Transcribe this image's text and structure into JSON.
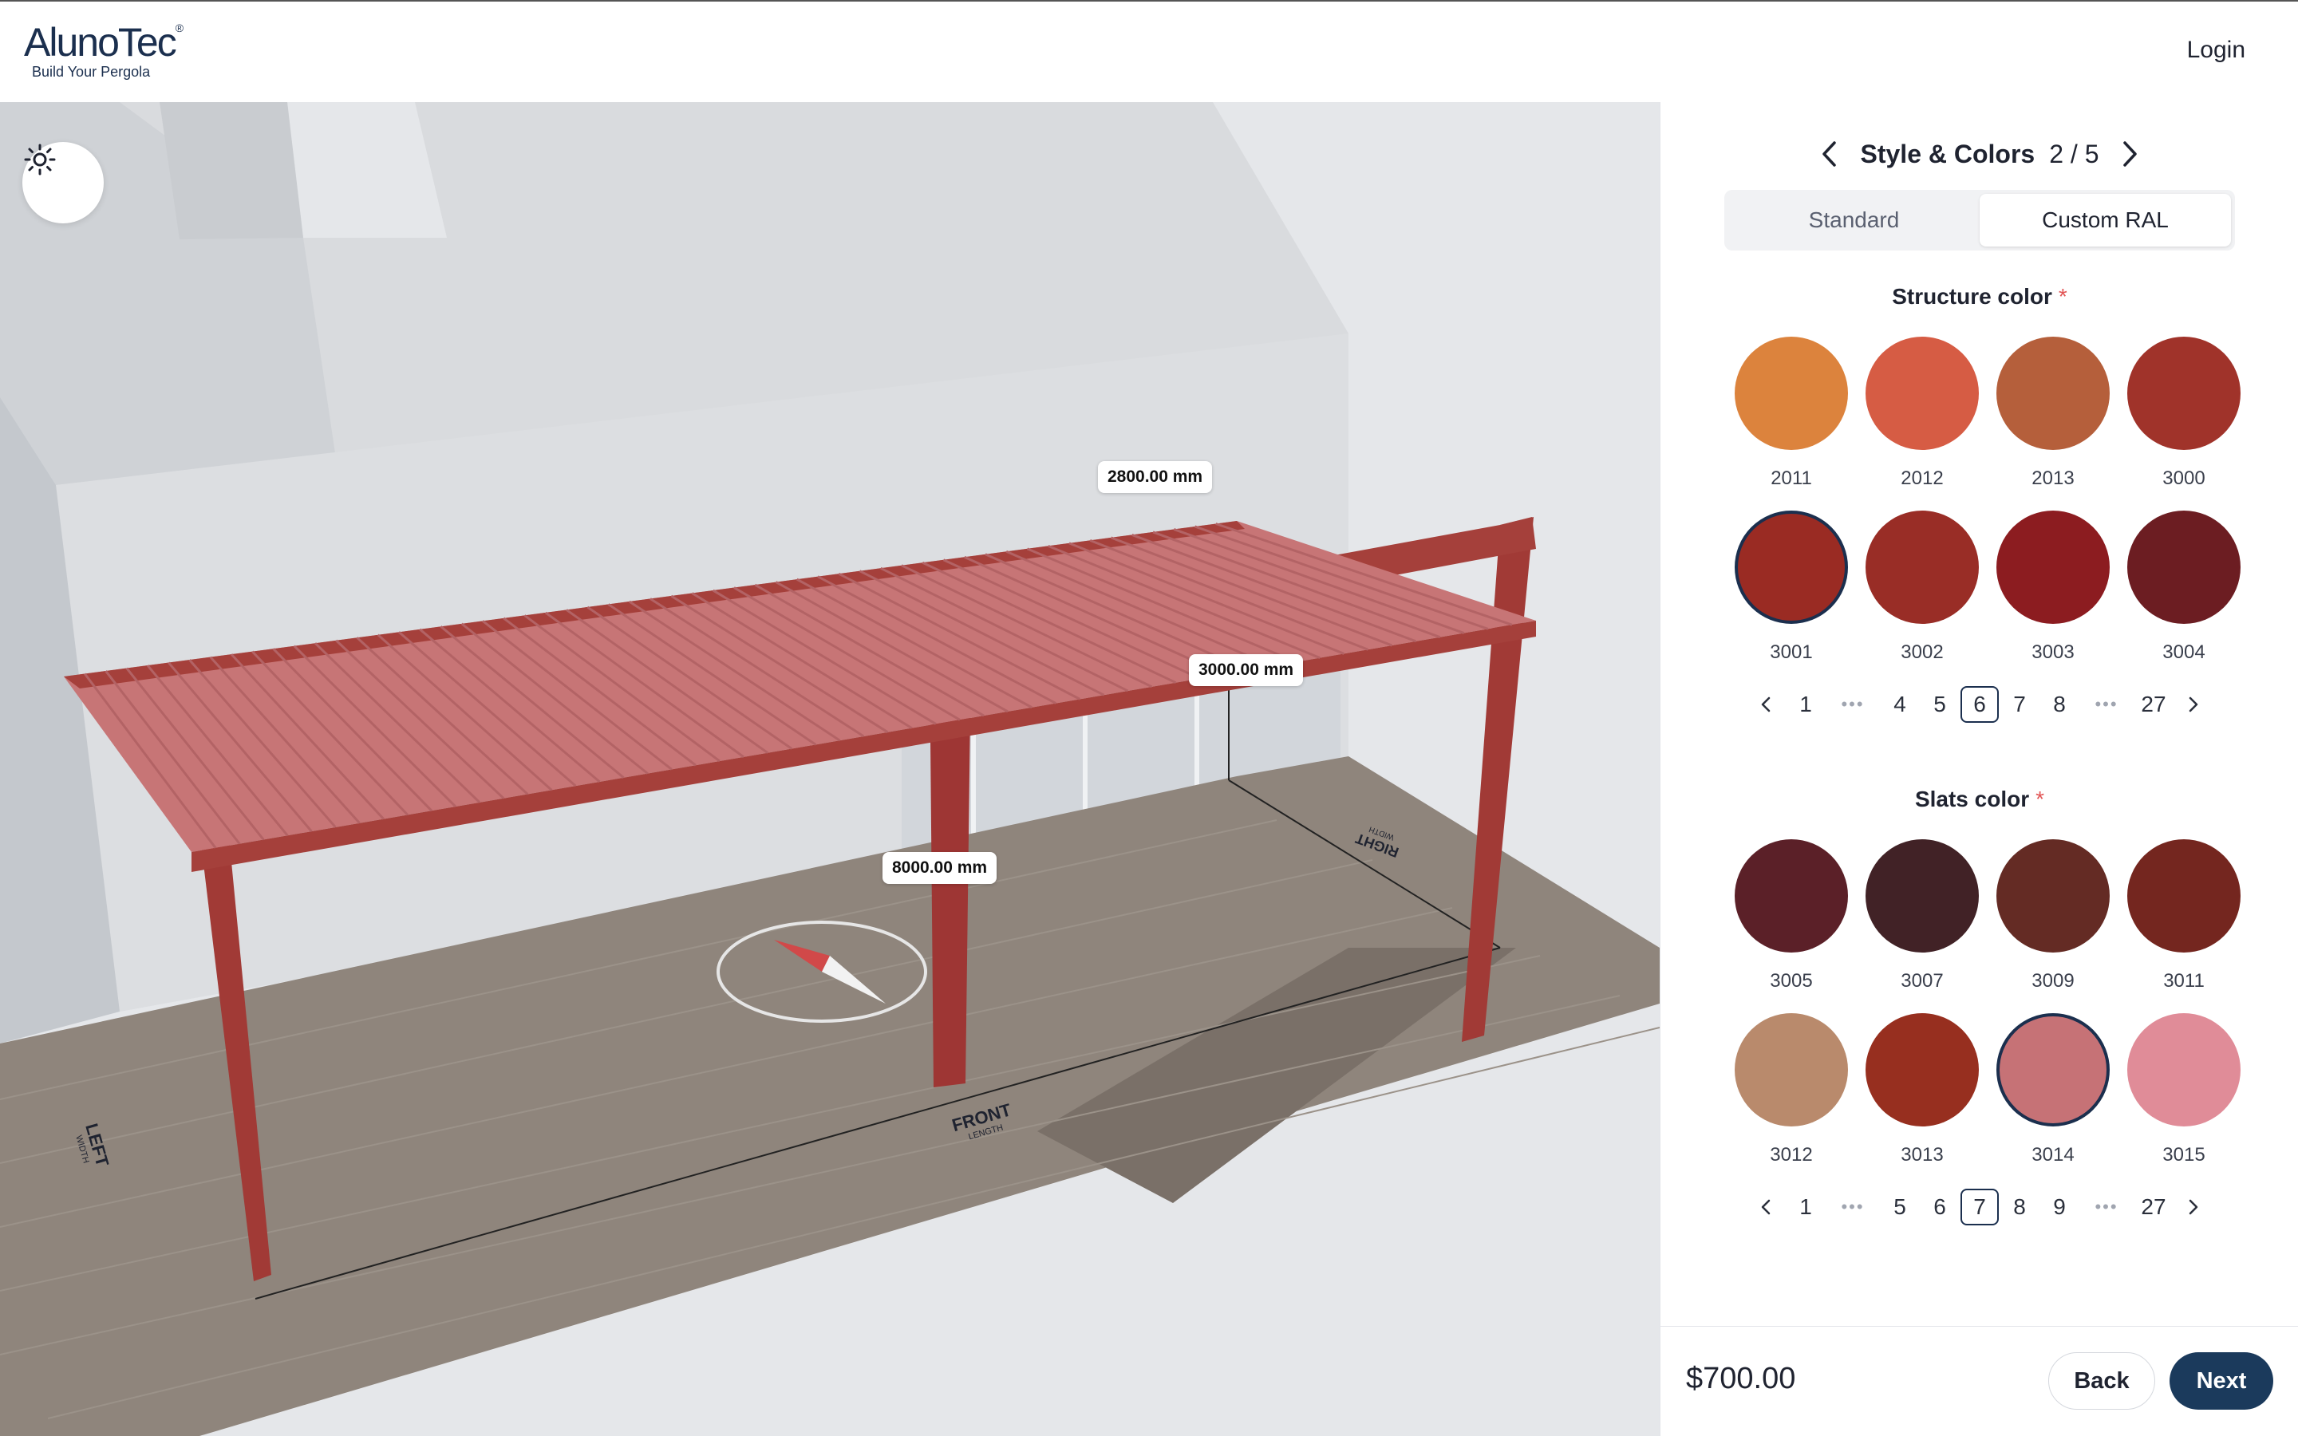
{
  "header": {
    "logo_main": "AlunoTec",
    "logo_reg": "®",
    "logo_tagline": "Build Your Pergola",
    "login_label": "Login"
  },
  "viewport": {
    "dimensions": {
      "depth": "2800.00 mm",
      "height": "3000.00 mm",
      "length": "8000.00 mm"
    },
    "ground_labels": {
      "front": "FRONT",
      "front_sub": "LENGTH",
      "left": "LEFT",
      "left_sub": "WIDTH",
      "right": "RIGHT",
      "right_sub": "WIDTH"
    },
    "icons": {
      "light": "sun-icon"
    },
    "colors": {
      "structure": "#9b3535",
      "slats": "#c77576",
      "deck": "#8f857c"
    }
  },
  "panel": {
    "step_title": "Style & Colors",
    "step_count": "2 / 5",
    "tabs": [
      {
        "label": "Standard",
        "active": false
      },
      {
        "label": "Custom RAL",
        "active": true
      }
    ],
    "structure": {
      "title": "Structure color",
      "required_mark": "*",
      "swatches": [
        {
          "code": "2011",
          "color": "#dc833d",
          "selected": false
        },
        {
          "code": "2012",
          "color": "#d65c44",
          "selected": false
        },
        {
          "code": "2013",
          "color": "#b55f3b",
          "selected": false
        },
        {
          "code": "3000",
          "color": "#a0332a",
          "selected": false
        },
        {
          "code": "3001",
          "color": "#9a2b23",
          "selected": true
        },
        {
          "code": "3002",
          "color": "#992d26",
          "selected": false
        },
        {
          "code": "3003",
          "color": "#8c1c20",
          "selected": false
        },
        {
          "code": "3004",
          "color": "#6c1d22",
          "selected": false
        }
      ],
      "pagination": [
        "1",
        "•••",
        "4",
        "5",
        "6",
        "7",
        "8",
        "•••",
        "27"
      ],
      "current_page": "6"
    },
    "slats": {
      "title": "Slats color",
      "required_mark": "*",
      "swatches": [
        {
          "code": "3005",
          "color": "#5b2028",
          "selected": false
        },
        {
          "code": "3007",
          "color": "#412226",
          "selected": false
        },
        {
          "code": "3009",
          "color": "#642b24",
          "selected": false
        },
        {
          "code": "3011",
          "color": "#74261f",
          "selected": false
        },
        {
          "code": "3012",
          "color": "#b98a6c",
          "selected": false
        },
        {
          "code": "3013",
          "color": "#972f1f",
          "selected": false
        },
        {
          "code": "3014",
          "color": "#c67276",
          "selected": true
        },
        {
          "code": "3015",
          "color": "#e08c98",
          "selected": false
        }
      ],
      "pagination": [
        "1",
        "•••",
        "5",
        "6",
        "7",
        "8",
        "9",
        "•••",
        "27"
      ],
      "current_page": "7"
    },
    "footer": {
      "price": "$700.00",
      "back_label": "Back",
      "next_label": "Next"
    }
  }
}
